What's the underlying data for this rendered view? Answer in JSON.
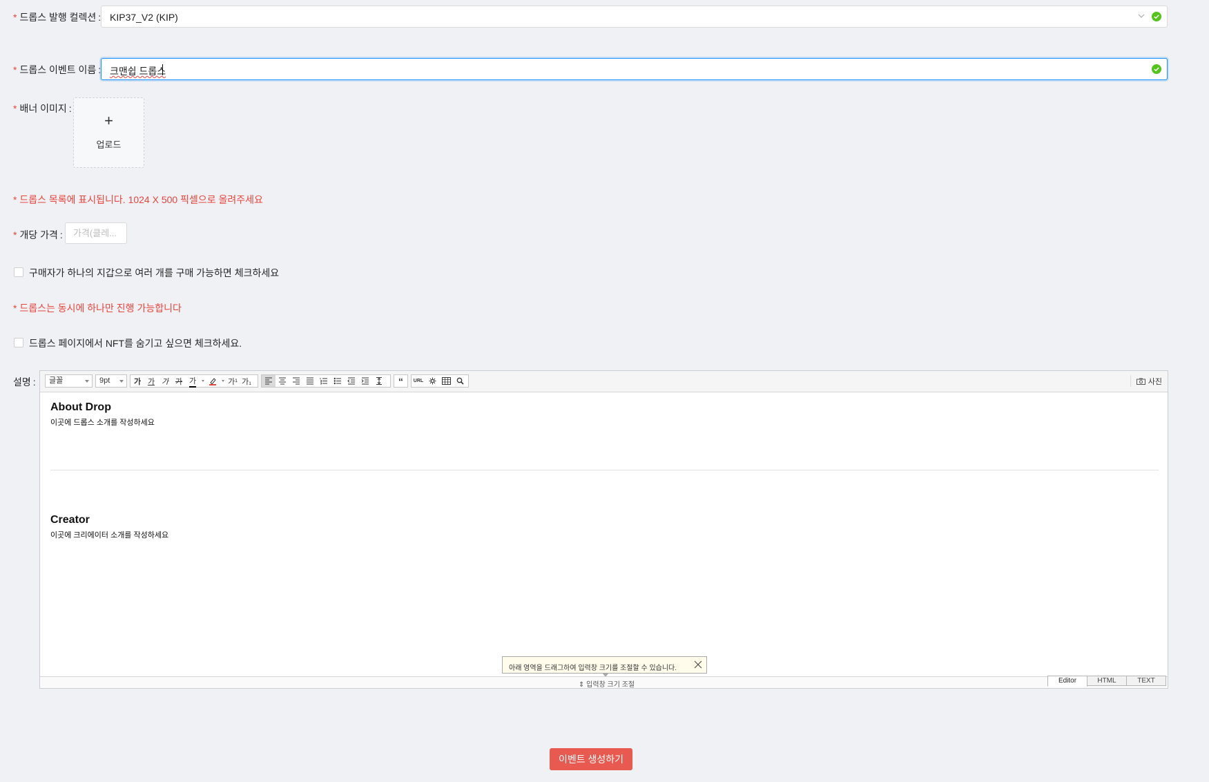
{
  "fields": {
    "collection": {
      "label": "드롭스 발행 컬렉션",
      "value": "KIP37_V2 (KIP)"
    },
    "event_name": {
      "label": "드롭스 이벤트 이름",
      "value": "크맨쉽 드롭스"
    },
    "banner": {
      "label": "배너 이미지",
      "upload_plus": "+",
      "upload_label": "업로드"
    },
    "price": {
      "label": "개당 가격",
      "placeholder": "가격(클레..."
    }
  },
  "notices": {
    "banner_notice": "* 드롭스 목록에 표시됩니다. 1024 X 500 픽셀으로 올려주세요",
    "concurrent_notice": "* 드롭스는 동시에 하나만 진행 가능합니다"
  },
  "checkboxes": {
    "multi_purchase": "구매자가 하나의 지갑으로 여러 개를 구매 가능하면 체크하세요",
    "hide_nft": "드롭스 페이지에서 NFT를 숨기고 싶으면 체크하세요."
  },
  "description": {
    "label": "설명",
    "toolbar": {
      "font_select": "글꼴",
      "size_select": "9pt",
      "bold": "가",
      "underline": "가",
      "italic": "가",
      "strike": "가",
      "font_color": "가",
      "superscript": "가¹",
      "subscript": "가₁",
      "url": "URL",
      "photo": "사진"
    },
    "content": {
      "about_title": "About Drop",
      "about_text": "이곳에 드롭스 소개를 작성하세요",
      "creator_title": "Creator",
      "creator_text": "이곳에 크리에이터 소개를 작성하세요"
    },
    "tooltip": "아래 영역을 드래그하여 입력창 크기를 조절할 수 있습니다.",
    "resize_label": "입력창 크기 조절",
    "modes": [
      "Editor",
      "HTML",
      "TEXT"
    ]
  },
  "submit_label": "이벤트 생성하기",
  "colors": {
    "accent_red": "#e8453c",
    "button_red": "#e8594f",
    "focus_blue": "#1890ff",
    "success_green": "#52c41a"
  }
}
